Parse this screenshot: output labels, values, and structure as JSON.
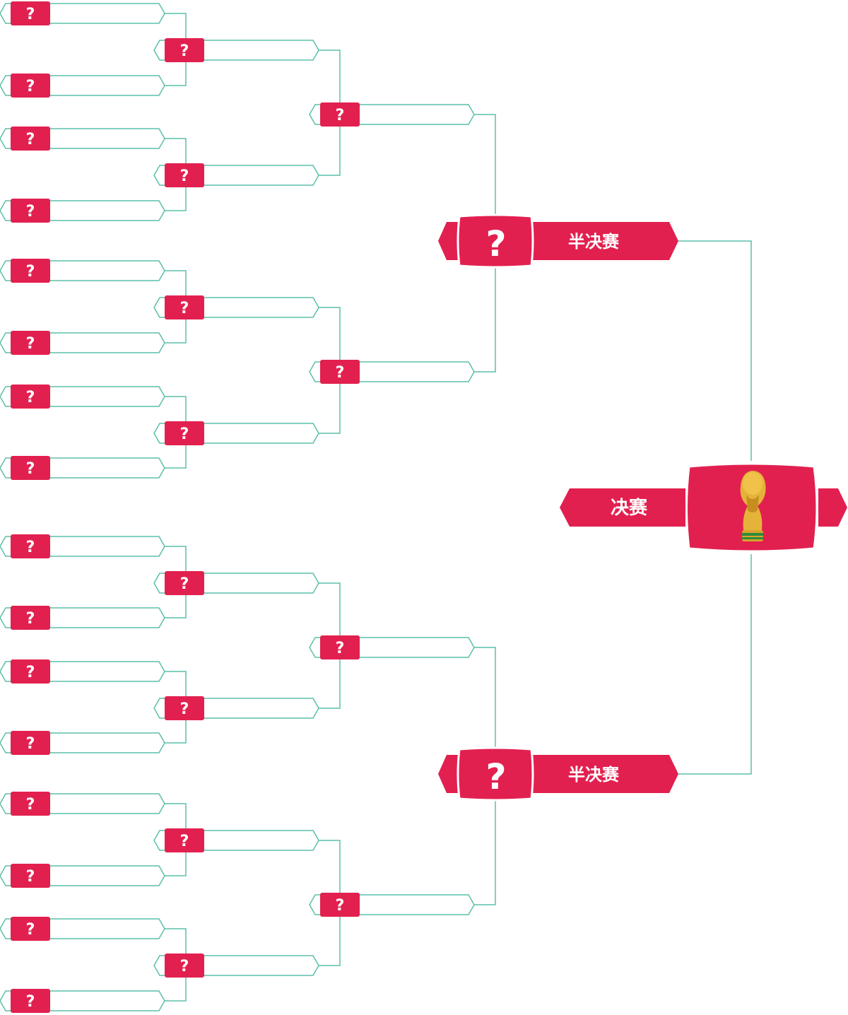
{
  "colors": {
    "accent": "#e2204f",
    "line": "#5bbfaa",
    "trophy": "#d9a42b"
  },
  "placeholder": "?",
  "round_of_32": {
    "slots": [
      "?",
      "?",
      "?",
      "?",
      "?",
      "?",
      "?",
      "?",
      "?",
      "?",
      "?",
      "?",
      "?",
      "?",
      "?",
      "?"
    ]
  },
  "round_of_16": {
    "slots": [
      "?",
      "?",
      "?",
      "?",
      "?",
      "?",
      "?",
      "?"
    ]
  },
  "quarter_finals": {
    "slots": [
      "?",
      "?",
      "?",
      "?"
    ]
  },
  "semi_finals": {
    "slots": [
      {
        "placeholder": "?",
        "label": "半决赛"
      },
      {
        "placeholder": "?",
        "label": "半决赛"
      }
    ]
  },
  "final": {
    "label": "决赛",
    "icon": "trophy-icon"
  }
}
